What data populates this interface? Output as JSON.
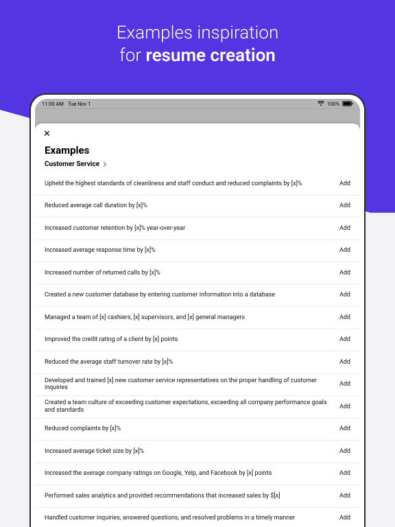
{
  "hero": {
    "line1": "Examples inspiration",
    "line2_pre": "for ",
    "line2_bold": "resume creation"
  },
  "statusbar": {
    "time": "11:00 AM",
    "date": "Tue Nov 1",
    "battery_label": "100%"
  },
  "sheet": {
    "title": "Examples",
    "category": "Customer Service",
    "add_label": "Add"
  },
  "examples": [
    "Upheld the highest standards of cleanliness and staff conduct and reduced complaints by [x]%",
    "Reduced average call duration by [x]%",
    "Increased customer retention by [x]% year-over-year",
    "Increased average response time by [x]%",
    "Increased number of returned calls by [x]%",
    "Created a new customer database by entering customer information into a database",
    "Managed a team of [x] cashiers, [x] supervisors, and [x] general managers",
    "Improved the credit rating of a client by [x] points",
    "Reduced the average staff turnover rate by [x]%",
    "Developed and trained [x] new customer service representatives on the proper handling of customer inquiries",
    "Created a team culture of exceeding customer expectations, exceeding all company performance goals and standards",
    "Reduced complaints by [x]%",
    "Increased average ticket size by [x]%",
    "Increased the average company ratings on Google, Yelp, and Facebook by [x] points",
    "Performed sales analytics and provided recommendations that increased sales by $[x]",
    "Handled customer inquiries, answered questions, and resolved problems in a timely manner"
  ]
}
